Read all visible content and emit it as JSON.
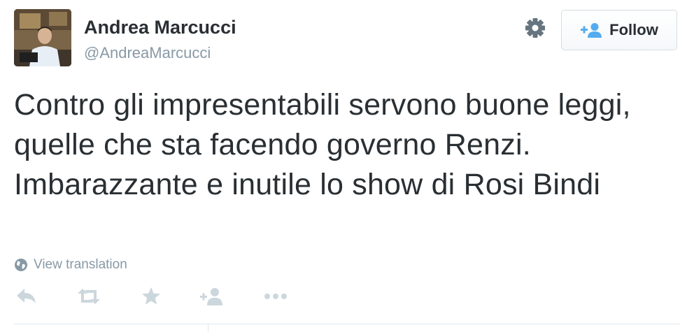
{
  "author": {
    "name": "Andrea Marcucci",
    "handle": "@AndreaMarcucci"
  },
  "follow_button": {
    "label": "Follow"
  },
  "tweet": {
    "text": "Contro gli impresentabili servono buone leggi, quelle che sta facendo governo Renzi. Imbarazzante e inutile lo show di Rosi Bindi"
  },
  "translation": {
    "label": "View translation"
  },
  "actions": [
    {
      "icon": "reply-icon"
    },
    {
      "icon": "retweet-icon"
    },
    {
      "icon": "favorite-star-icon"
    },
    {
      "icon": "follow-user-icon"
    },
    {
      "icon": "more-dots-icon"
    }
  ],
  "colors": {
    "text": "#292f33",
    "muted": "#8899a6",
    "icon": "#ccd6dd",
    "accent": "#55acee",
    "border": "#e1e8ed"
  }
}
